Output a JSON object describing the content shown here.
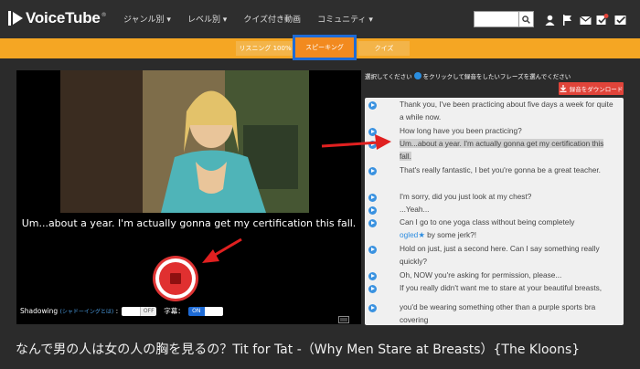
{
  "app": {
    "name": "VoiceTube",
    "trademark": "®"
  },
  "nav": {
    "items": [
      {
        "label": "ジャンル別 ▾"
      },
      {
        "label": "レベル別 ▾"
      },
      {
        "label": "クイズ付き動画"
      },
      {
        "label": "コミュニティ ▾"
      }
    ],
    "search": {
      "value": "",
      "placeholder": ""
    }
  },
  "tabs": {
    "listening": "リスニング 100%",
    "speaking": "スピーキング",
    "quiz": "クイズ"
  },
  "video": {
    "subtitle": "Um...about a year. I'm actually gonna get my certification this fall."
  },
  "controls": {
    "shadowing_label": "Shadowing",
    "shadowing_link": "(シャドーイングとは)",
    "colon": ":",
    "shadowing_state": "OFF",
    "subtitles_label": "字幕：",
    "subtitles_state": "ON"
  },
  "panel": {
    "instruction_before": "選択してください",
    "instruction_after": "をクリックして録音をしたいフレーズを選んでください",
    "download_label": "録音をダウンロード",
    "lines": [
      {
        "text": "Thank you, I've been practicing about five days a week for quite a while now."
      },
      {
        "text": "How long have you been practicing?"
      },
      {
        "text": "Um...about a year. I'm actually gonna get my certification this fall."
      },
      {
        "text": "That's really fantastic, I bet you're gonna be a great teacher."
      },
      {
        "text": "I'm sorry, did you just look at my chest?"
      },
      {
        "text": "...Yeah..."
      },
      {
        "text": "Can I go to one yoga class without being completely"
      },
      {
        "blue": "ogled",
        "rest": "by some jerk?!"
      },
      {
        "text": "Hold on just, just a second here. Can I say something really quickly?"
      },
      {
        "text": "Oh, NOW you're asking for permission, please..."
      },
      {
        "text": "If you really didn't want me to stare at your beautiful breasts,"
      },
      {
        "text": "you'd be wearing something other than a purple sports bra covering"
      }
    ]
  },
  "page_title": "なんで男の人は女の人の胸を見るの？Tit for Tat -（Why Men Stare at Breasts）{The Kloons}",
  "colors": {
    "accent_orange": "#f5a623",
    "selected_blue": "#1e6bd6",
    "record_red": "#e03030",
    "download_red": "#e0443a"
  }
}
